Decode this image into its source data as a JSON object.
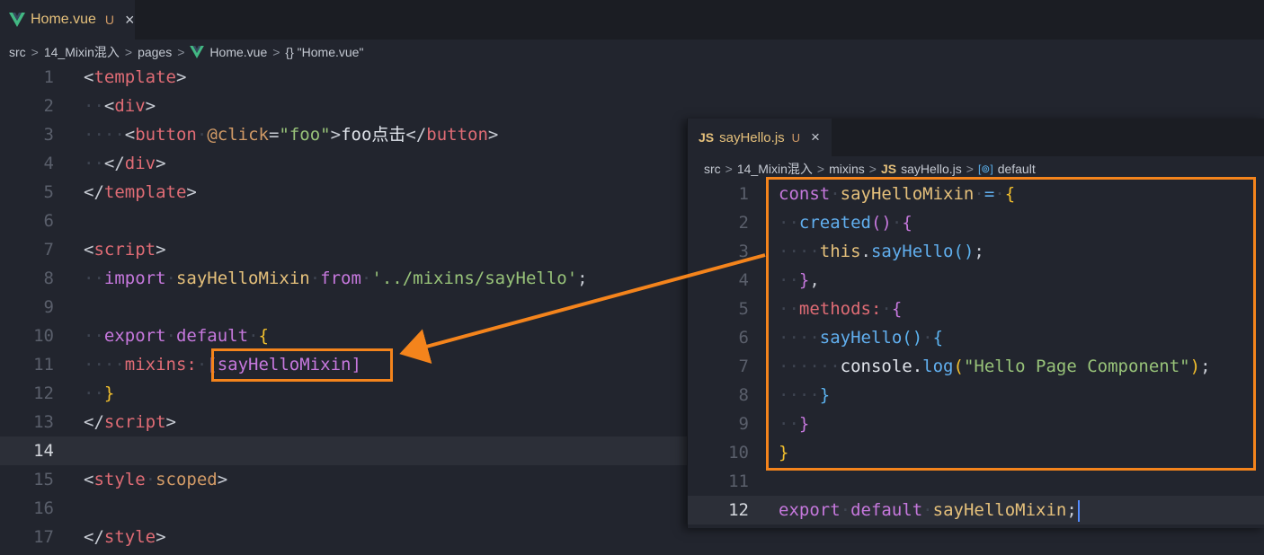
{
  "main_tab": {
    "filename": "Home.vue",
    "status": "U",
    "close": "×",
    "icon": "vue-logo-icon"
  },
  "main_breadcrumb": {
    "items": [
      "src",
      "14_Mixin混入",
      "pages",
      "Home.vue",
      "{} \"Home.vue\""
    ],
    "separator": ">"
  },
  "main_code": {
    "line_numbers": [
      "1",
      "2",
      "3",
      "4",
      "5",
      "6",
      "7",
      "8",
      "9",
      "10",
      "11",
      "12",
      "13",
      "14",
      "15",
      "16",
      "17"
    ],
    "active_line": "14",
    "l1_tag": "template",
    "l2_tag": "div",
    "l3_tag": "button",
    "l3_attr": "@click",
    "l3_val": "\"foo\"",
    "l3_text": "foo点击",
    "l4_tag": "div",
    "l5_tag": "template",
    "l7_tag": "script",
    "l8_kw1": "import",
    "l8_var": "sayHelloMixin",
    "l8_kw2": "from",
    "l8_str": "'../mixins/sayHello'",
    "l8_end": ";",
    "l10_kw1": "export",
    "l10_kw2": "default",
    "l11_prop": "mixins:",
    "l11_arr": "[sayHelloMixin]",
    "l13_tag": "script",
    "l15_tag": "style",
    "l15_attr": "scoped",
    "l17_tag": "style"
  },
  "popup_tab": {
    "badge": "JS",
    "filename": "sayHello.js",
    "status": "U",
    "close": "×"
  },
  "popup_breadcrumb": {
    "items": [
      "src",
      "14_Mixin混入",
      "mixins",
      "sayHello.js",
      "default"
    ],
    "badge": "JS",
    "symbol_icon": "[⊚]",
    "separator": ">"
  },
  "popup_code": {
    "line_numbers": [
      "1",
      "2",
      "3",
      "4",
      "5",
      "6",
      "7",
      "8",
      "9",
      "10",
      "11",
      "12"
    ],
    "active_line": "12",
    "l1_kw": "const",
    "l1_var": "sayHelloMixin",
    "l1_eq": "=",
    "l2_fn": "created",
    "l3_this": "this",
    "l3_fn": "sayHello",
    "l5_prop": "methods:",
    "l6_fn": "sayHello",
    "l7_obj": "console.",
    "l7_fn": "log",
    "l7_str": "\"Hello Page Component\"",
    "l12_kw1": "export",
    "l12_kw2": "default",
    "l12_var": "sayHelloMixin"
  },
  "colors": {
    "highlight": "#f4841c",
    "background": "#22252e"
  }
}
